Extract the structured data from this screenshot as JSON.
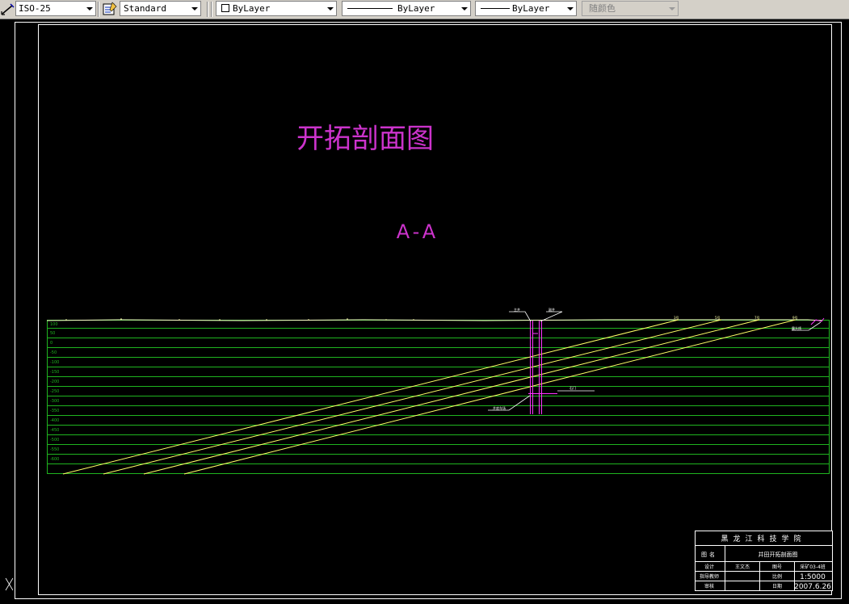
{
  "toolbar": {
    "dimstyle": "ISO-25",
    "textstyle": "Standard",
    "layer_color": "ByLayer",
    "linetype": "ByLayer",
    "lineweight": "ByLayer",
    "plotstyle": "随颜色"
  },
  "drawing": {
    "title": "开拓剖面图",
    "section_label": "A-A",
    "elevation_labels": [
      "100",
      "50",
      "0",
      "-50",
      "-100",
      "-150",
      "-200",
      "-250",
      "-300",
      "-350",
      "-400",
      "-450",
      "-500",
      "-550",
      "-600"
    ],
    "annotations": {
      "shaft_left": "主井",
      "shaft_right": "副井",
      "station": "井底车场",
      "crosscut": "石门",
      "coal_1": "3号",
      "coal_2": "5号",
      "coal_3": "7号",
      "coal_4": "9号",
      "outcrop": "露头线"
    }
  },
  "titleblock": {
    "school": "黑龙江科技学院",
    "name_label": "图名",
    "name_value": "井田开拓剖面图",
    "r1c1": "设计",
    "r1c2": "王文杰",
    "r1c3": "图号",
    "r1c4": "采矿03-4班",
    "r2c1": "指导教师",
    "r2c3": "比例",
    "r2c4": "1:5000",
    "r3c1": "审核",
    "r3c3": "日期",
    "r3c4": "2007.6.26"
  },
  "colors": {
    "frame": "#ffffff",
    "title": "#cc33cc",
    "grid": "#1fb41f",
    "seam": "#ffff66",
    "shaft": "#ff33ff"
  }
}
